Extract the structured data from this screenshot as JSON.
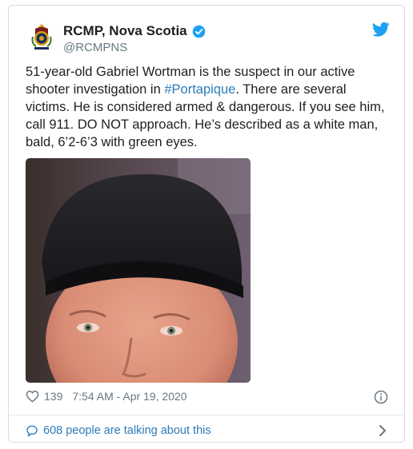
{
  "tweet": {
    "account_name": "RCMP, Nova Scotia",
    "handle": "@RCMPNS",
    "text_before_hashtag": "51-year-old Gabriel Wortman is the suspect in our active shooter investigation in ",
    "hashtag": "#Portapique",
    "text_after_hashtag": ". There are several victims. He is considered armed & dangerous. If you see him, call 911. DO NOT approach. He’s described as a white man, bald, 6’2-6’3 with green eyes.",
    "likes": "139",
    "timestamp": "7:54 AM - Apr 19, 2020",
    "conversation_link": "608 people are talking about this"
  },
  "colors": {
    "link_blue": "#2b7bb9",
    "twitter_blue": "#1da1f2",
    "meta_gray": "#697882",
    "border": "#d6dde2"
  },
  "icons": {
    "logo": "rcmp-crest-icon",
    "verified": "verified-badge-icon",
    "brand": "twitter-bird-icon",
    "like": "heart-icon",
    "info": "info-icon",
    "conversation": "speech-bubble-icon",
    "expand": "chevron-right-icon"
  }
}
